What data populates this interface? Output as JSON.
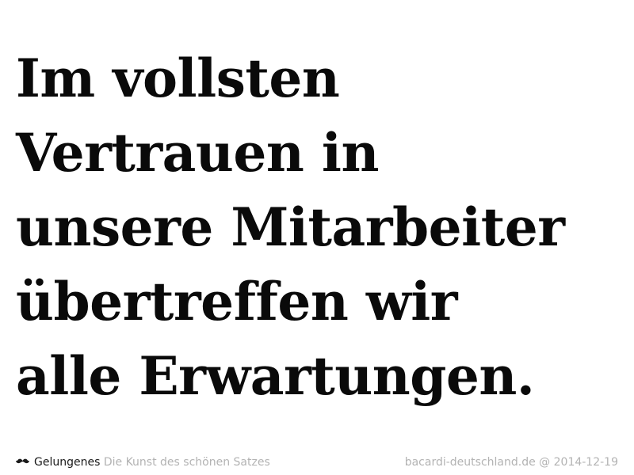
{
  "quote": {
    "lines": [
      "Im vollsten",
      "Vertrauen in",
      "unsere Mitarbeiter",
      "übertreffen wir",
      "alle Erwartungen."
    ]
  },
  "footer": {
    "brand": "Gelungenes",
    "tagline": "Die Kunst des schönen Satzes",
    "source": "bacardi-deutschland.de",
    "separator": "@",
    "date": "2014-12-19",
    "icon": "mustache-icon"
  },
  "colors": {
    "background": "#ffffff",
    "quote_text": "#0a0a0a",
    "brand_text": "#1a1a1a",
    "muted_text": "#b3b3b3"
  }
}
